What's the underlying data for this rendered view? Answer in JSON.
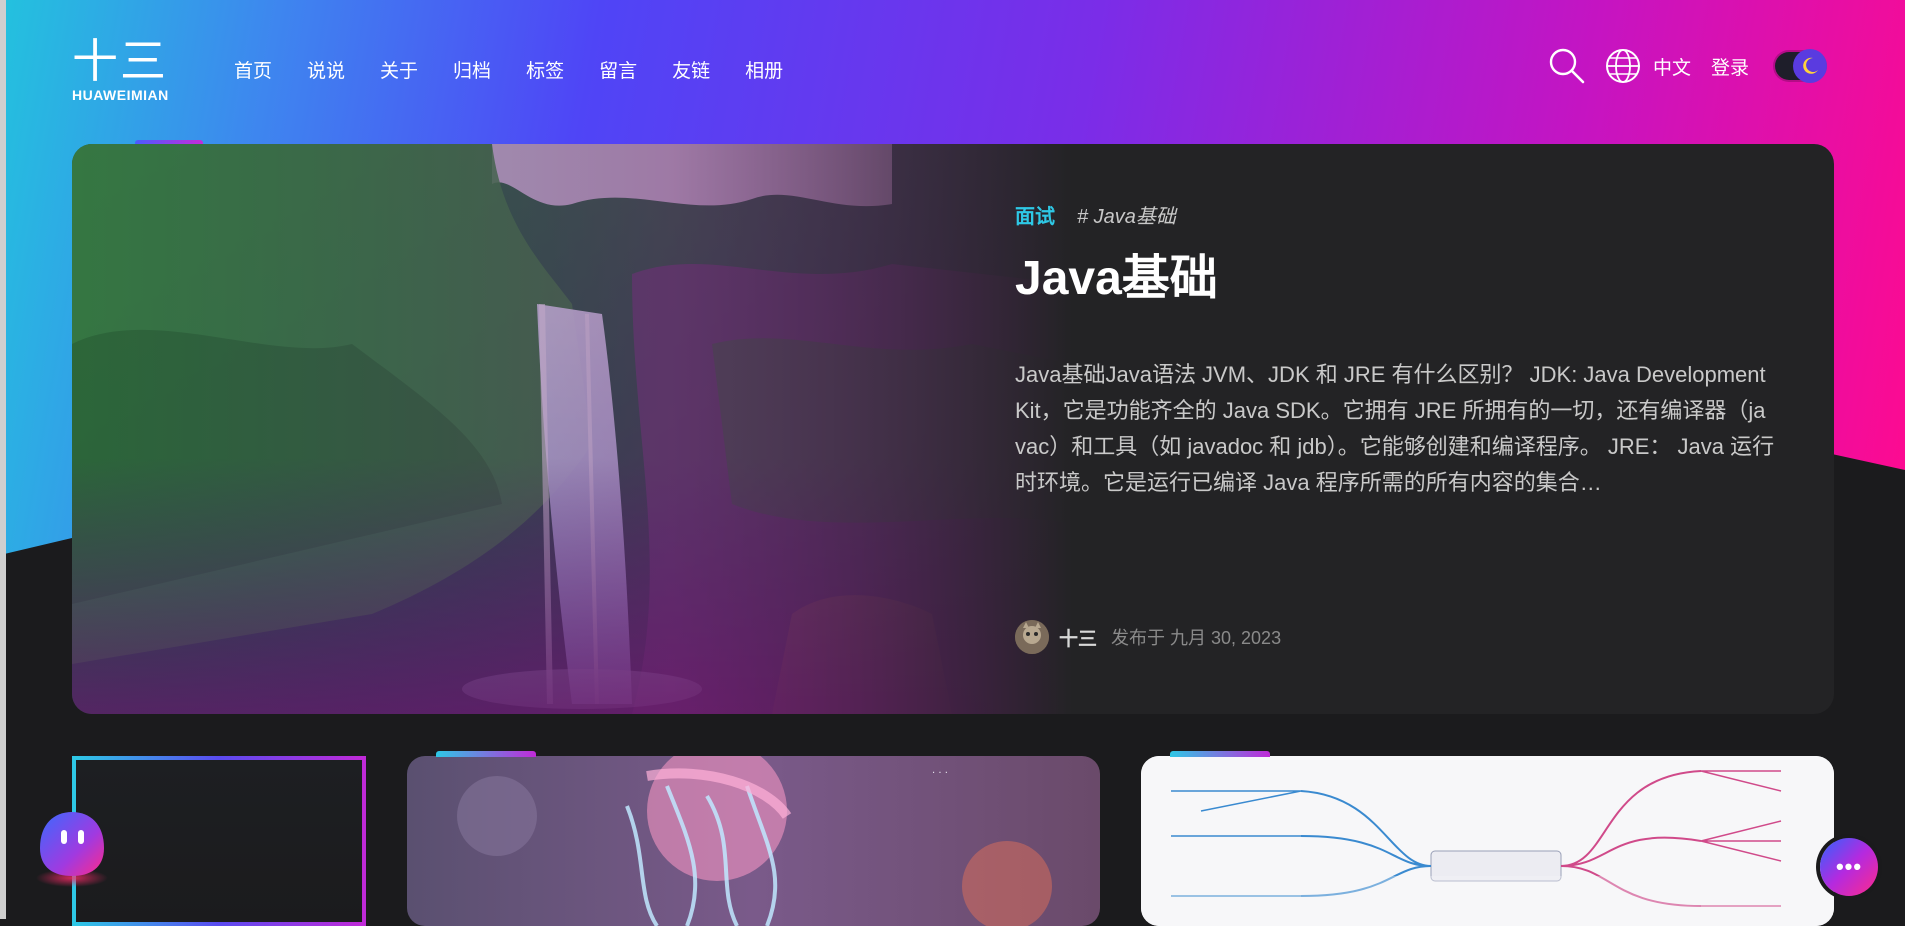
{
  "brand": {
    "mark": "十三",
    "name": "HUAWEIMIAN"
  },
  "nav": [
    "首页",
    "说说",
    "关于",
    "归档",
    "标签",
    "留言",
    "友链",
    "相册"
  ],
  "tools": {
    "search_icon": "search-icon",
    "globe_icon": "globe-icon",
    "language": "中文",
    "login": "登录",
    "theme_icon": "moon-icon"
  },
  "featured": {
    "category": "面试",
    "tag": "# Java基础",
    "title": "Java基础",
    "excerpt": "Java基础Java语法 JVM、JDK 和 JRE 有什么区别？ JDK: Java Development Kit，它是功能齐全的 Java SDK。它拥有 JRE 所拥有的一切，还有编译器（javac）和工具（如 javadoc 和 jdb）。它能够创建和编译程序。 JRE： Java 运行时环境。它是运行已编译 Java 程序所需的所有内容的集合…",
    "author": "十三",
    "date": "发布于 九月 30, 2023"
  },
  "colors": {
    "accent": "#2ec8e6",
    "gradient_start": "#23c2de",
    "gradient_mid": "#4f45f6",
    "gradient_end": "#ff0a8f",
    "background": "#1b1b1d",
    "card": "#232325"
  }
}
